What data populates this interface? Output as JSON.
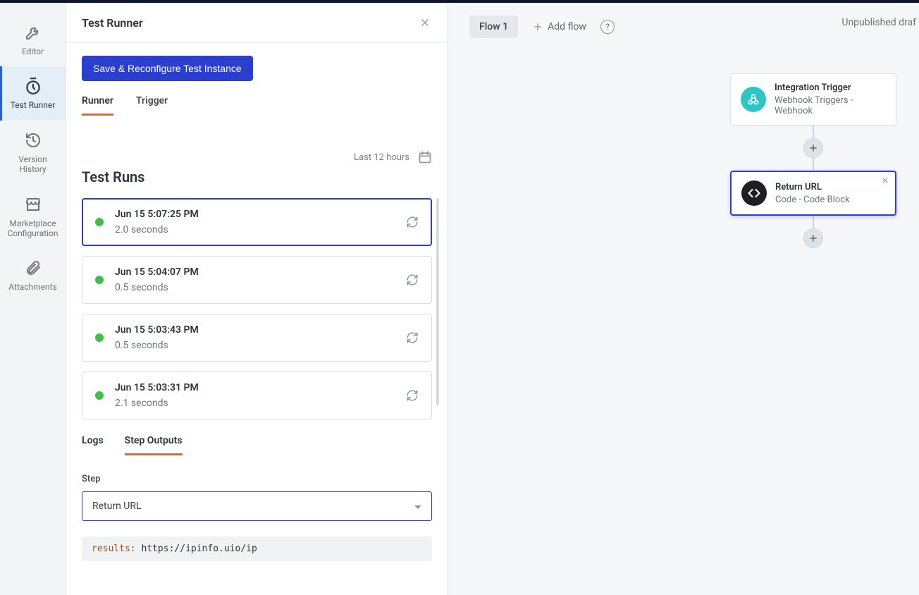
{
  "sidebar": {
    "items": [
      {
        "label": "Editor"
      },
      {
        "label": "Test Runner"
      },
      {
        "label": "Version History"
      },
      {
        "label": "Marketplace Configuration"
      },
      {
        "label": "Attachments"
      }
    ]
  },
  "panel": {
    "title": "Test Runner",
    "save_button": "Save & Reconfigure Test Instance",
    "tabs": {
      "runner": "Runner",
      "trigger": "Trigger"
    },
    "time_filter": "Last 12 hours",
    "section_title": "Test Runs",
    "runs": [
      {
        "time": "Jun 15 5:07:25 PM",
        "duration": "2.0 seconds"
      },
      {
        "time": "Jun 15 5:04:07 PM",
        "duration": "0.5 seconds"
      },
      {
        "time": "Jun 15 5:03:43 PM",
        "duration": "0.5 seconds"
      },
      {
        "time": "Jun 15 5:03:31 PM",
        "duration": "2.1 seconds"
      }
    ],
    "sub_tabs": {
      "logs": "Logs",
      "step_outputs": "Step Outputs"
    },
    "step_label": "Step",
    "step_select_value": "Return URL",
    "results_key": "results:",
    "results_value": "https://ipinfo.uio/ip"
  },
  "canvas": {
    "flow_tab": "Flow 1",
    "add_flow": "Add flow",
    "draft": "Unpublished draf",
    "node1": {
      "title": "Integration Trigger",
      "subtitle": "Webhook Triggers - Webhook"
    },
    "node2": {
      "title": "Return URL",
      "subtitle": "Code - Code Block"
    }
  },
  "colors": {
    "primary_blue": "#2a3fd0",
    "accent_orange": "#e56a1c",
    "success_green": "#3dbf4a",
    "teal": "#2dc6c4"
  }
}
